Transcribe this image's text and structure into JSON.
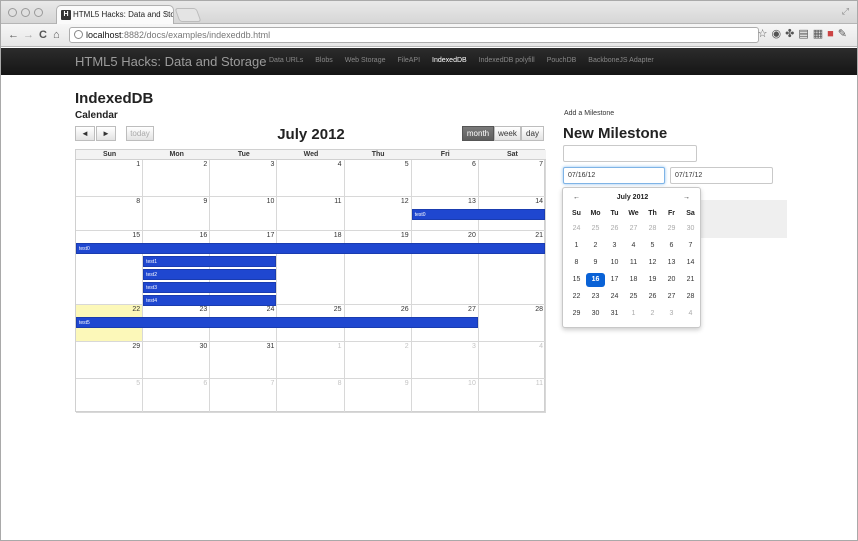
{
  "browser": {
    "tab_title": "HTML5 Hacks: Data and Sto",
    "tab_favicon": "H",
    "url_host": "localhost",
    "url_path": ":8882/docs/examples/indexeddb.html",
    "back_glyph": "←",
    "forward_glyph": "→",
    "reload_glyph": "C",
    "home_glyph": "⌂",
    "close_glyph": "×"
  },
  "navbar": {
    "brand": "HTML5 Hacks: Data and Storage",
    "links": [
      {
        "label": "Data URLs",
        "active": false
      },
      {
        "label": "Blobs",
        "active": false
      },
      {
        "label": "Web Storage",
        "active": false
      },
      {
        "label": "FileAPI",
        "active": false
      },
      {
        "label": "IndexedDB",
        "active": true
      },
      {
        "label": "IndexedDB polyfill",
        "active": false
      },
      {
        "label": "PouchDB",
        "active": false
      },
      {
        "label": "BackboneJS Adapter",
        "active": false
      }
    ]
  },
  "page": {
    "title": "IndexedDB",
    "subtitle": "Calendar"
  },
  "calendar": {
    "title": "July 2012",
    "prev_glyph": "◄",
    "next_glyph": "►",
    "today_label": "today",
    "view_month": "month",
    "view_week": "week",
    "view_day": "day",
    "weekdays": [
      "Sun",
      "Mon",
      "Tue",
      "Wed",
      "Thu",
      "Fri",
      "Sat"
    ],
    "weeks": [
      [
        {
          "d": "",
          "o": false
        },
        {
          "d": "1",
          "o": false
        },
        {
          "d": "2",
          "o": false
        },
        {
          "d": "3",
          "o": false
        },
        {
          "d": "4",
          "o": false
        },
        {
          "d": "5",
          "o": false
        },
        {
          "d": "6",
          "o": false
        },
        {
          "d": "7",
          "o": false
        }
      ],
      [
        {
          "d": "8",
          "o": false
        },
        {
          "d": "9",
          "o": false
        },
        {
          "d": "10",
          "o": false
        },
        {
          "d": "11",
          "o": false
        },
        {
          "d": "12",
          "o": false
        },
        {
          "d": "13",
          "o": false
        },
        {
          "d": "14",
          "o": false
        }
      ],
      [
        {
          "d": "15",
          "o": false
        },
        {
          "d": "16",
          "o": false
        },
        {
          "d": "17",
          "o": false
        },
        {
          "d": "18",
          "o": false
        },
        {
          "d": "19",
          "o": false
        },
        {
          "d": "20",
          "o": false
        },
        {
          "d": "21",
          "o": false
        }
      ],
      [
        {
          "d": "22",
          "o": false
        },
        {
          "d": "23",
          "o": false
        },
        {
          "d": "24",
          "o": false
        },
        {
          "d": "25",
          "o": false
        },
        {
          "d": "26",
          "o": false
        },
        {
          "d": "27",
          "o": false
        },
        {
          "d": "28",
          "o": false
        }
      ],
      [
        {
          "d": "29",
          "o": false
        },
        {
          "d": "30",
          "o": false
        },
        {
          "d": "31",
          "o": false
        },
        {
          "d": "1",
          "o": true
        },
        {
          "d": "2",
          "o": true
        },
        {
          "d": "3",
          "o": true
        },
        {
          "d": "4",
          "o": true
        }
      ],
      [
        {
          "d": "5",
          "o": true
        },
        {
          "d": "6",
          "o": true
        },
        {
          "d": "7",
          "o": true
        },
        {
          "d": "8",
          "o": true
        },
        {
          "d": "9",
          "o": true
        },
        {
          "d": "10",
          "o": true
        },
        {
          "d": "11",
          "o": true
        }
      ]
    ],
    "today": "22",
    "events": [
      {
        "label": "test0",
        "week": 1,
        "start": 5,
        "end": 6,
        "lane": 0
      },
      {
        "label": "test0",
        "week": 2,
        "start": 0,
        "end": 6,
        "lane": 0
      },
      {
        "label": "test1",
        "week": 2,
        "start": 1,
        "end": 2,
        "lane": 1
      },
      {
        "label": "test2",
        "week": 2,
        "start": 1,
        "end": 2,
        "lane": 2
      },
      {
        "label": "test3",
        "week": 2,
        "start": 1,
        "end": 2,
        "lane": 3
      },
      {
        "label": "test4",
        "week": 2,
        "start": 1,
        "end": 2,
        "lane": 4
      },
      {
        "label": "test5",
        "week": 3,
        "start": 0,
        "end": 5,
        "lane": 0
      }
    ]
  },
  "milestone": {
    "section_label": "Add a Milestone",
    "heading": "New Milestone",
    "name_value": "",
    "start_value": "07/16/12",
    "end_value": "07/17/12"
  },
  "datepicker": {
    "title": "July 2012",
    "prev_glyph": "←",
    "next_glyph": "→",
    "weekdays": [
      "Su",
      "Mo",
      "Tu",
      "We",
      "Th",
      "Fr",
      "Sa"
    ],
    "rows": [
      [
        {
          "d": "24",
          "o": true
        },
        {
          "d": "25",
          "o": true
        },
        {
          "d": "26",
          "o": true
        },
        {
          "d": "27",
          "o": true
        },
        {
          "d": "28",
          "o": true
        },
        {
          "d": "29",
          "o": true
        },
        {
          "d": "30",
          "o": true
        }
      ],
      [
        {
          "d": "1",
          "o": false
        },
        {
          "d": "2",
          "o": false
        },
        {
          "d": "3",
          "o": false
        },
        {
          "d": "4",
          "o": false
        },
        {
          "d": "5",
          "o": false
        },
        {
          "d": "6",
          "o": false
        },
        {
          "d": "7",
          "o": false
        }
      ],
      [
        {
          "d": "8",
          "o": false
        },
        {
          "d": "9",
          "o": false
        },
        {
          "d": "10",
          "o": false
        },
        {
          "d": "11",
          "o": false
        },
        {
          "d": "12",
          "o": false
        },
        {
          "d": "13",
          "o": false
        },
        {
          "d": "14",
          "o": false
        }
      ],
      [
        {
          "d": "15",
          "o": false
        },
        {
          "d": "16",
          "o": false
        },
        {
          "d": "17",
          "o": false
        },
        {
          "d": "18",
          "o": false
        },
        {
          "d": "19",
          "o": false
        },
        {
          "d": "20",
          "o": false
        },
        {
          "d": "21",
          "o": false
        }
      ],
      [
        {
          "d": "22",
          "o": false
        },
        {
          "d": "23",
          "o": false
        },
        {
          "d": "24",
          "o": false
        },
        {
          "d": "25",
          "o": false
        },
        {
          "d": "26",
          "o": false
        },
        {
          "d": "27",
          "o": false
        },
        {
          "d": "28",
          "o": false
        }
      ],
      [
        {
          "d": "29",
          "o": false
        },
        {
          "d": "30",
          "o": false
        },
        {
          "d": "31",
          "o": false
        },
        {
          "d": "1",
          "o": true
        },
        {
          "d": "2",
          "o": true
        },
        {
          "d": "3",
          "o": true
        },
        {
          "d": "4",
          "o": true
        }
      ]
    ],
    "selected": "16"
  }
}
